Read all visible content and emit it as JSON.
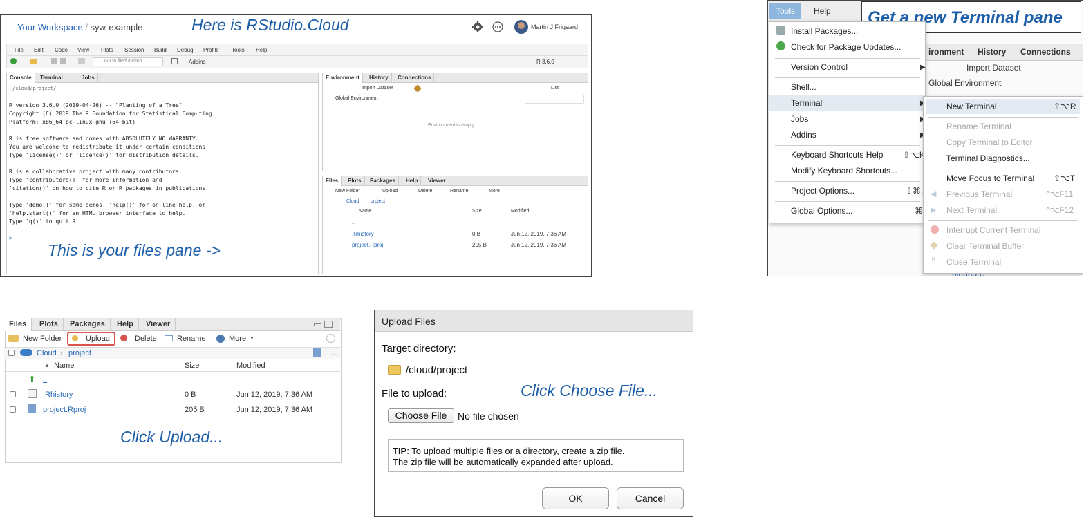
{
  "colors": {
    "callout": "#1d5ea8",
    "link": "#2a6ab6",
    "upload_highlight": "#d9534f",
    "menu_highlight": "#e4eaf2"
  },
  "rstudio": {
    "workspace_link": "Your Workspace",
    "separator": "/",
    "project_name": "syw-example",
    "callout": "Here is RStudio.Cloud",
    "user_name": "Martin J Frigaard",
    "menu": [
      "File",
      "Edit",
      "Code",
      "View",
      "Plots",
      "Session",
      "Build",
      "Debug",
      "Profile",
      "Tools",
      "Help"
    ],
    "goto_placeholder": "Go to file/function",
    "addins": "Addins",
    "r_version": "R 3.6.0",
    "left_tabs": [
      "Console",
      "Terminal",
      "Jobs"
    ],
    "console_path": "/cloud/project/",
    "console_lines": [
      "R version 3.6.0 (2019-04-26) -- \"Planting of a Tree\"",
      "Copyright (C) 2019 The R Foundation for Statistical Computing",
      "Platform: x86_64-pc-linux-gnu (64-bit)",
      "",
      "R is free software and comes with ABSOLUTELY NO WARRANTY.",
      "You are welcome to redistribute it under certain conditions.",
      "Type 'license()' or 'licence()' for distribution details.",
      "",
      "R is a collaborative project with many contributors.",
      "Type 'contributors()' for more information and",
      "'citation()' on how to cite R or R packages in publications.",
      "",
      "Type 'demo()' for some demos, 'help()' for on-line help, or",
      "'help.start()' for an HTML browser interface to help.",
      "Type 'q()' to quit R."
    ],
    "prompt": ">",
    "files_callout": "This is your files pane ->",
    "env_tabs": [
      "Environment",
      "History",
      "Connections"
    ],
    "import_dataset": "Import Dataset",
    "list_label": "List",
    "global_env": "Global Environment",
    "env_empty": "Environment is empty",
    "files_tabs": [
      "Files",
      "Plots",
      "Packages",
      "Help",
      "Viewer"
    ],
    "files_toolbar": {
      "new_folder": "New Folder",
      "upload": "Upload",
      "delete": "Delete",
      "rename": "Rename",
      "more": "More"
    },
    "breadcrumb": [
      "Cloud",
      "project"
    ],
    "columns": [
      "Name",
      "Size",
      "Modified"
    ],
    "files": [
      {
        "name": "..",
        "size": "",
        "modified": ""
      },
      {
        "name": ".Rhistory",
        "size": "0 B",
        "modified": "Jun 12, 2019, 7:36 AM"
      },
      {
        "name": "project.Rproj",
        "size": "205 B",
        "modified": "Jun 12, 2019, 7:36 AM"
      }
    ]
  },
  "tools_menu": {
    "menubar": [
      "Tools",
      "Help"
    ],
    "callout": "Get a new Terminal pane",
    "bg_tabs": [
      "ironment",
      "History",
      "Connections"
    ],
    "bg_import": "Import Dataset",
    "bg_global": "Global Environment",
    "bg_file": "dlupnore",
    "items": [
      {
        "label": "Install Packages...",
        "shortcut": ""
      },
      {
        "label": "Check for Package Updates...",
        "shortcut": ""
      },
      {
        "label": "Version Control",
        "shortcut": ""
      },
      {
        "label": "Shell...",
        "shortcut": ""
      },
      {
        "label": "Terminal",
        "shortcut": ""
      },
      {
        "label": "Jobs",
        "shortcut": ""
      },
      {
        "label": "Addins",
        "shortcut": ""
      },
      {
        "label": "Keyboard Shortcuts Help",
        "shortcut": "⇧⌥K"
      },
      {
        "label": "Modify Keyboard Shortcuts...",
        "shortcut": ""
      },
      {
        "label": "Project Options...",
        "shortcut": "⇧⌘,"
      },
      {
        "label": "Global Options...",
        "shortcut": "⌘,"
      }
    ],
    "submenu": [
      {
        "label": "New Terminal",
        "shortcut": "⇧⌥R",
        "disabled": false
      },
      {
        "label": "Rename Terminal",
        "shortcut": "",
        "disabled": true
      },
      {
        "label": "Copy Terminal to Editor",
        "shortcut": "",
        "disabled": true
      },
      {
        "label": "Terminal Diagnostics...",
        "shortcut": "",
        "disabled": false
      },
      {
        "label": "Move Focus to Terminal",
        "shortcut": "⇧⌥T",
        "disabled": false
      },
      {
        "label": "Previous Terminal",
        "shortcut": "^⌥F11",
        "disabled": true
      },
      {
        "label": "Next Terminal",
        "shortcut": "^⌥F12",
        "disabled": true
      },
      {
        "label": "Interrupt Current Terminal",
        "shortcut": "",
        "disabled": true
      },
      {
        "label": "Clear Terminal Buffer",
        "shortcut": "",
        "disabled": true
      },
      {
        "label": "Close Terminal",
        "shortcut": "",
        "disabled": true
      }
    ]
  },
  "files_pane": {
    "tabs": [
      "Files",
      "Plots",
      "Packages",
      "Help",
      "Viewer"
    ],
    "toolbar": {
      "new_folder": "New Folder",
      "upload": "Upload",
      "delete": "Delete",
      "rename": "Rename",
      "more": "More"
    },
    "breadcrumb": [
      "Cloud",
      "project"
    ],
    "columns": [
      "Name",
      "Size",
      "Modified"
    ],
    "files": [
      {
        "name": "..",
        "size": "",
        "modified": ""
      },
      {
        "name": ".Rhistory",
        "size": "0 B",
        "modified": "Jun 12, 2019, 7:36 AM"
      },
      {
        "name": "project.Rproj",
        "size": "205 B",
        "modified": "Jun 12, 2019, 7:36 AM"
      }
    ],
    "callout": "Click Upload..."
  },
  "upload_dialog": {
    "title": "Upload Files",
    "target_label": "Target directory:",
    "target_path": "/cloud/project",
    "file_label": "File to upload:",
    "callout": "Click Choose File...",
    "choose_button": "Choose File",
    "no_file": "No file chosen",
    "tip_bold": "TIP",
    "tip_text": ": To upload multiple files or a directory, create a zip file.",
    "tip_text2": "The zip file will be automatically expanded after upload.",
    "ok": "OK",
    "cancel": "Cancel"
  }
}
